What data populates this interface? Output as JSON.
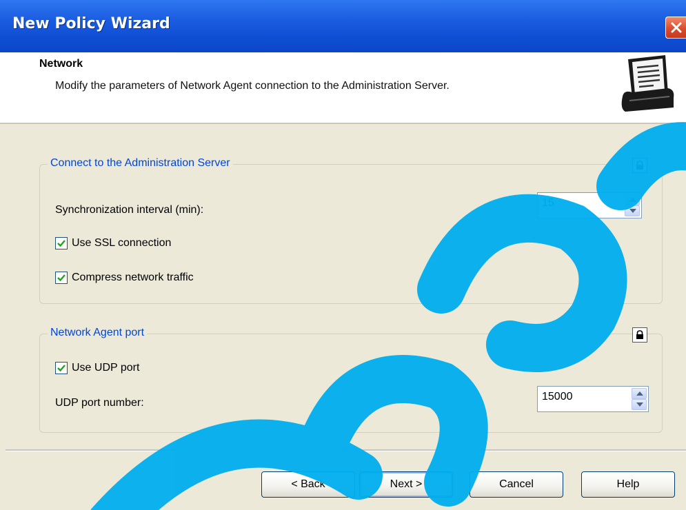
{
  "window": {
    "title": "New Policy Wizard"
  },
  "header": {
    "title": "Network",
    "subtitle": "Modify the parameters of Network Agent connection to the Administration Server."
  },
  "group_connect": {
    "label": "Connect to the Administration Server",
    "sync_label": "Synchronization interval (min):",
    "sync_value": "15",
    "ssl_label": "Use SSL connection",
    "ssl_checked": true,
    "compress_label": "Compress network traffic",
    "compress_checked": true
  },
  "group_port": {
    "label": "Network Agent port",
    "udp_label": "Use UDP port",
    "udp_checked": true,
    "udp_port_label": "UDP port number:",
    "udp_port_value": "15000"
  },
  "buttons": {
    "back": "< Back",
    "next": "Next >",
    "cancel": "Cancel",
    "help": "Help"
  },
  "colors": {
    "titlebar": "#0b46c7",
    "group_label": "#0046d5",
    "dialog_bg": "#ece9d8",
    "watermark": "#00aeef"
  }
}
